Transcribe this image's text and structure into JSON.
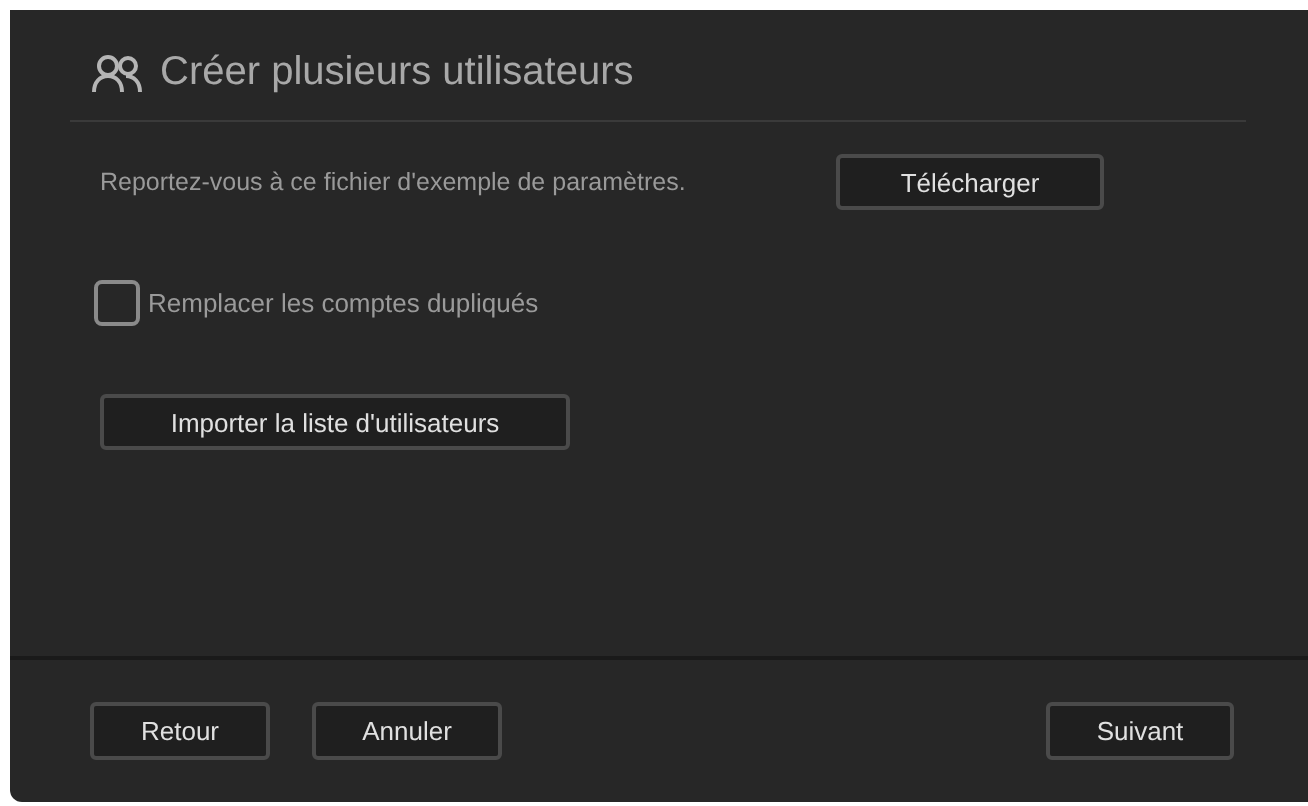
{
  "dialog": {
    "title": "Créer plusieurs utilisateurs",
    "sample_text": "Reportez-vous à ce fichier d'exemple de paramètres.",
    "download_button": "Télécharger",
    "replace_duplicates": {
      "label": "Remplacer les comptes dupliqués",
      "checked": false
    },
    "import_button": "Importer la liste d'utilisateurs",
    "footer_left_buttons": [
      "Retour",
      "Annuler"
    ],
    "footer_right_buttons": [
      "Suivant"
    ]
  }
}
